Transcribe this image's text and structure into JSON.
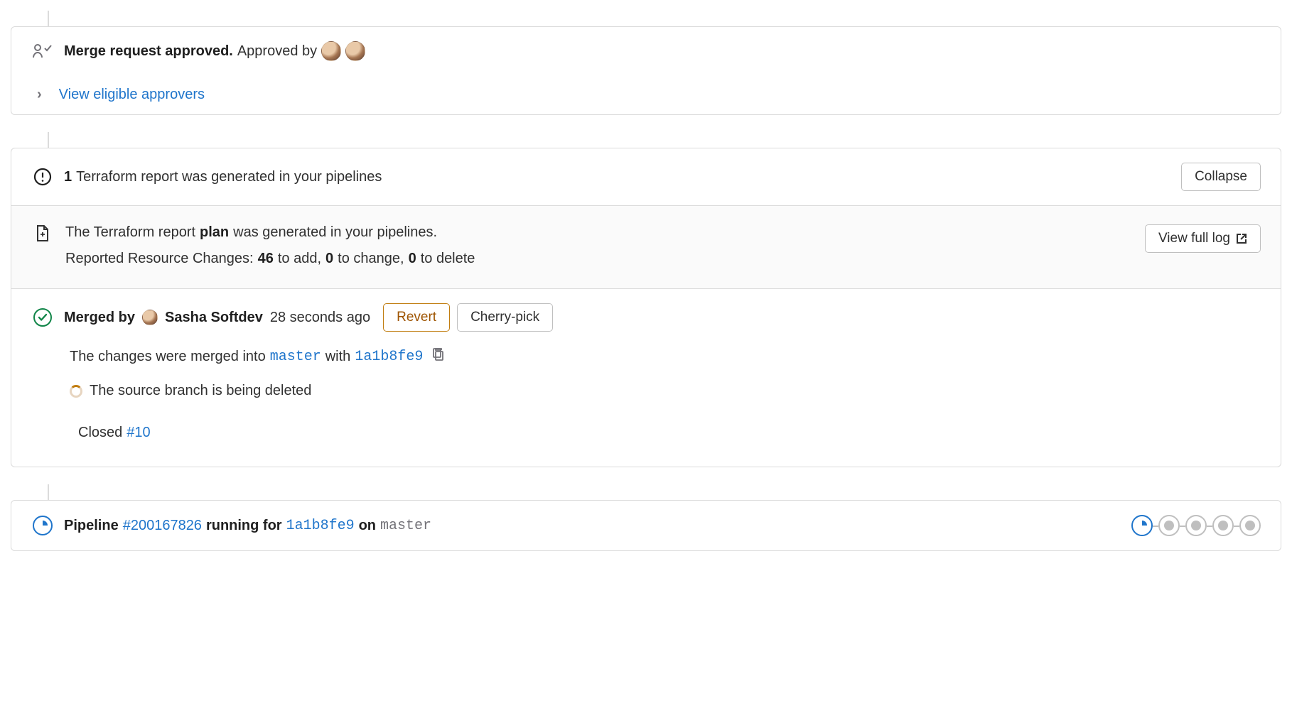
{
  "approval": {
    "title_strong": "Merge request approved.",
    "title_rest": "Approved by",
    "expand_link": "View eligible approvers"
  },
  "terraform": {
    "header_count": "1",
    "header_text": "Terraform report was generated in your pipelines",
    "collapse_btn": "Collapse",
    "body_prefix": "The Terraform report",
    "body_plan": "plan",
    "body_suffix": "was generated in your pipelines.",
    "changes_prefix": "Reported Resource Changes:",
    "add_n": "46",
    "add_t": "to add,",
    "change_n": "0",
    "change_t": "to change,",
    "delete_n": "0",
    "delete_t": "to delete",
    "view_log_btn": "View full log"
  },
  "merged": {
    "prefix": "Merged by",
    "author": "Sasha Softdev",
    "time": "28 seconds ago",
    "revert_btn": "Revert",
    "cherry_btn": "Cherry-pick",
    "line1_prefix": "The changes were merged into",
    "branch": "master",
    "line1_mid": "with",
    "commit": "1a1b8fe9",
    "line2": "The source branch is being deleted",
    "closed_prefix": "Closed",
    "closed_issue": "#10"
  },
  "pipeline": {
    "prefix": "Pipeline",
    "id": "#200167826",
    "mid1": "running for",
    "commit": "1a1b8fe9",
    "mid2": "on",
    "branch": "master"
  }
}
